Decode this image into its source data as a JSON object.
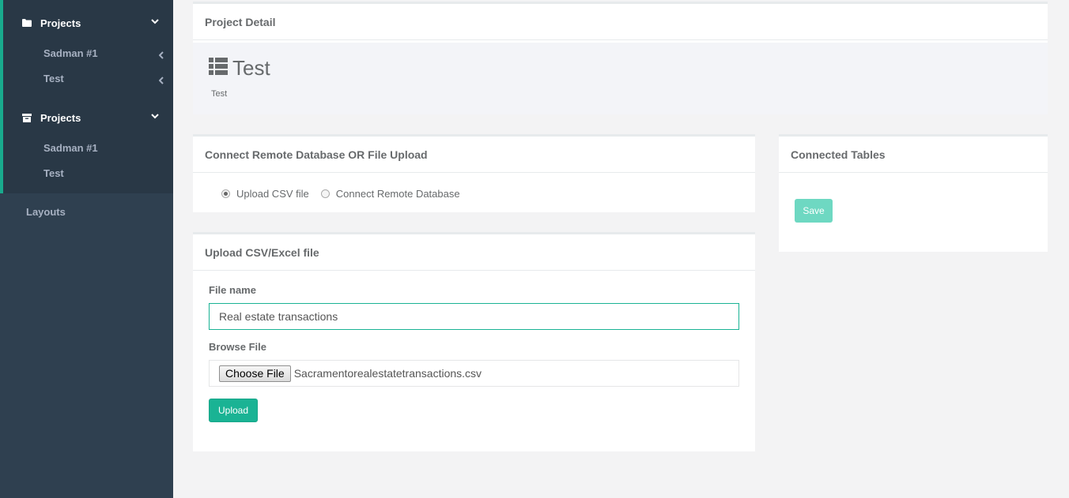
{
  "sidebar": {
    "groups": [
      {
        "title": "Projects",
        "icon": "folder-icon",
        "items": [
          "Sadman #1",
          "Test"
        ]
      },
      {
        "title": "Projects",
        "icon": "archive-icon",
        "items": [
          "Sadman #1",
          "Test"
        ]
      }
    ],
    "layouts_label": "Layouts"
  },
  "project_detail": {
    "panel_title": "Project Detail",
    "name": "Test",
    "description": "Test"
  },
  "connect": {
    "panel_title": "Connect Remote Database OR File Upload",
    "options": [
      "Upload CSV file",
      "Connect Remote Database"
    ],
    "selected": "Upload CSV file"
  },
  "upload": {
    "panel_title": "Upload CSV/Excel file",
    "file_name_label": "File name",
    "file_name_value": "Real estate transactions",
    "browse_label": "Browse File",
    "choose_file_label": "Choose File",
    "chosen_file": "Sacramentorealestatetransactions.csv",
    "upload_button": "Upload"
  },
  "connected_tables": {
    "panel_title": "Connected Tables",
    "save_button": "Save"
  },
  "colors": {
    "sidebar_bg": "#2f4050",
    "sidebar_active_bg": "#293846",
    "accent": "#1ab394",
    "page_bg": "#f3f3f4"
  }
}
